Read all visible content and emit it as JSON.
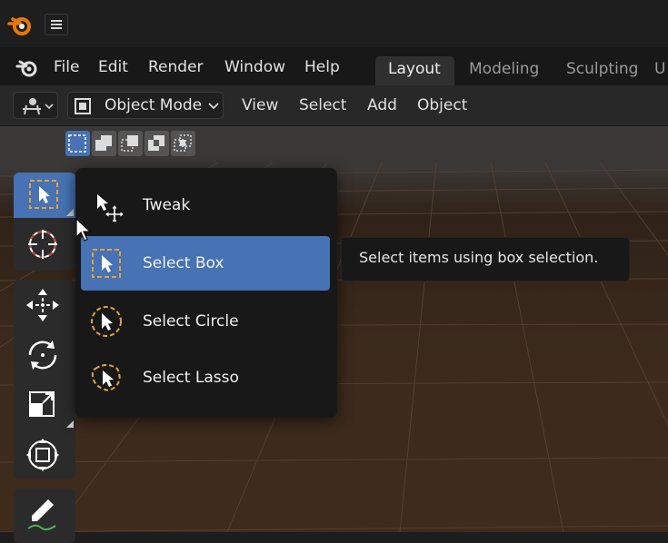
{
  "menubar": {
    "items": [
      "File",
      "Edit",
      "Render",
      "Window",
      "Help"
    ]
  },
  "workspace_tabs": [
    {
      "label": "Layout",
      "active": true
    },
    {
      "label": "Modeling",
      "active": false
    },
    {
      "label": "Sculpting",
      "active": false
    },
    {
      "label": "U",
      "active": false
    }
  ],
  "header": {
    "mode_label": "Object Mode",
    "menus": [
      "View",
      "Select",
      "Add",
      "Object"
    ]
  },
  "toolbar": {
    "tools": [
      "select-box",
      "cursor",
      "move",
      "rotate",
      "scale",
      "transform",
      "annotate"
    ]
  },
  "select_popup": {
    "items": [
      {
        "label": "Tweak",
        "icon": "tweak-icon",
        "active": false
      },
      {
        "label": "Select Box",
        "icon": "select-box-icon",
        "active": true
      },
      {
        "label": "Select Circle",
        "icon": "select-circle-icon",
        "active": false
      },
      {
        "label": "Select Lasso",
        "icon": "select-lasso-icon",
        "active": false
      }
    ]
  },
  "tooltip": {
    "text": "Select items using box selection."
  },
  "colors": {
    "accent": "#4772b3",
    "select_dash": "#e6a33a",
    "blender_orange": "#ea7600"
  }
}
